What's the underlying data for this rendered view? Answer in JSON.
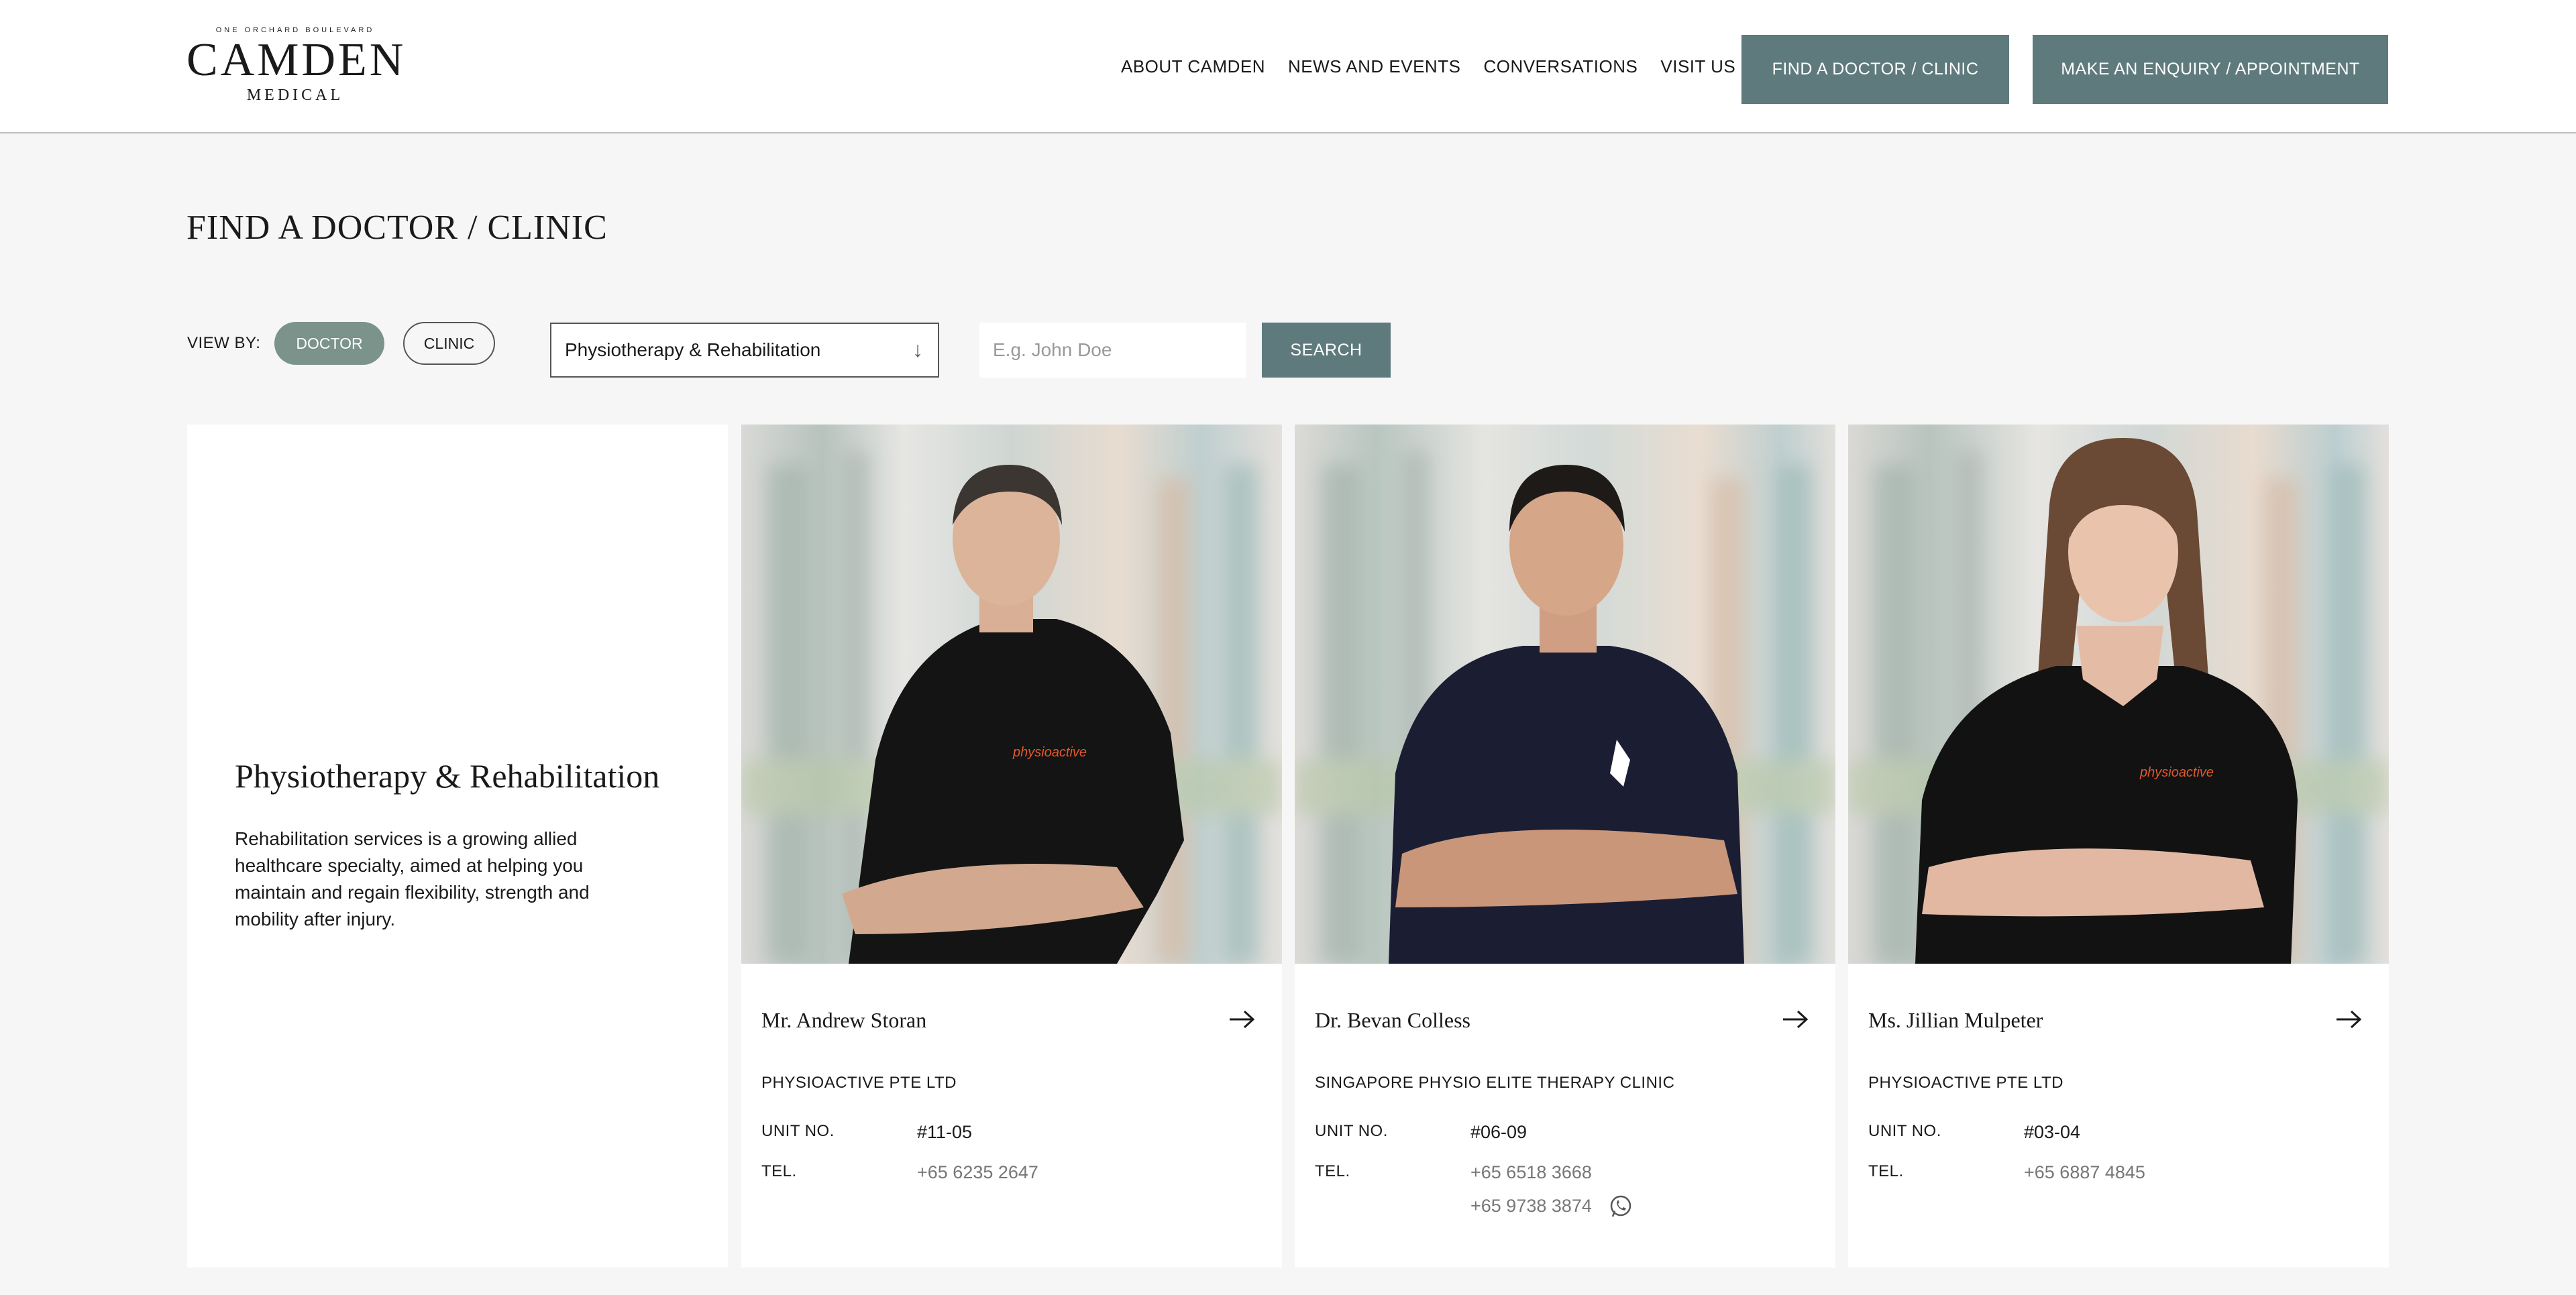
{
  "header": {
    "logo": {
      "top": "ONE ORCHARD BOULEVARD",
      "main": "CAMDEN",
      "sub": "MEDICAL"
    },
    "nav": [
      "ABOUT CAMDEN",
      "NEWS AND EVENTS",
      "CONVERSATIONS",
      "VISIT US"
    ],
    "find_button": "FIND A DOCTOR / CLINIC",
    "enquiry_button": "MAKE AN ENQUIRY / APPOINTMENT"
  },
  "page_title": "FIND A DOCTOR / CLINIC",
  "filters": {
    "view_by_label": "VIEW BY:",
    "doctor_pill": "DOCTOR",
    "clinic_pill": "CLINIC",
    "specialty_selected": "Physiotherapy & Rehabilitation",
    "search_placeholder": "E.g. John Doe",
    "search_button": "SEARCH"
  },
  "intro": {
    "title": "Physiotherapy & Rehabilitation",
    "description": "Rehabilitation services is a growing allied healthcare specialty, aimed at helping you maintain and regain flexibility, strength and mobility after injury."
  },
  "labels": {
    "unit": "UNIT NO.",
    "tel": "TEL."
  },
  "doctors": [
    {
      "name": "Mr. Andrew Storan",
      "clinic": "PHYSIOACTIVE PTE LTD",
      "unit": "#11-05",
      "tel": "+65 6235 2647",
      "tel2": "",
      "shirt_color": "#141414",
      "hair_color": "#3b3631"
    },
    {
      "name": "Dr. Bevan Colless",
      "clinic": "SINGAPORE PHYSIO ELITE THERAPY CLINIC",
      "unit": "#06-09",
      "tel": "+65 6518 3668",
      "tel2": "+65 9738 3874",
      "shirt_color": "#1b1e33",
      "hair_color": "#1e1a18"
    },
    {
      "name": "Ms. Jillian Mulpeter",
      "clinic": "PHYSIOACTIVE PTE LTD",
      "unit": "#03-04",
      "tel": "+65 6887 4845",
      "tel2": "",
      "shirt_color": "#121212",
      "hair_color": "#6a4a35"
    }
  ]
}
